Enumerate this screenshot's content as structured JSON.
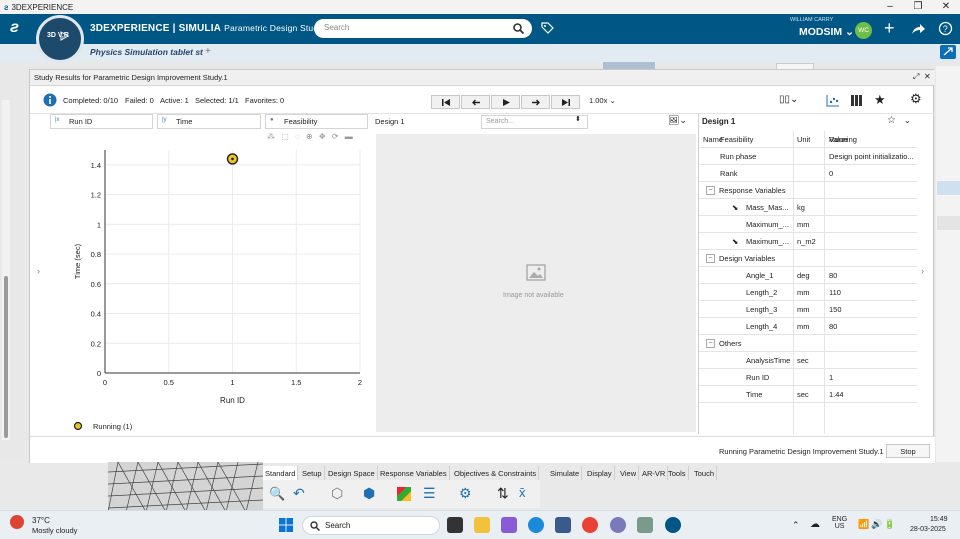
{
  "window": {
    "title": "3DEXPERIENCE",
    "controls": [
      "–",
      "❐",
      "✕"
    ]
  },
  "header": {
    "brand": "3DEXPERIENCE | SIMULIA",
    "brand_sub": "Parametric Design Study",
    "compass_label": "3D  V,R",
    "search_placeholder": "Search",
    "user_name": "WILLIAM CARRY",
    "user_app": "MODSIM",
    "avatar_initials": "WC",
    "tab_label": "Physics Simulation tablet st",
    "tab_plus": "+"
  },
  "panel": {
    "title": "Study Results for Parametric Design Improvement Study.1",
    "status": {
      "completed": "Completed: 0/10",
      "failed": "Failed: 0",
      "active": "Active: 1",
      "selected": "Selected: 1/1",
      "favorites": "Favorites: 0"
    },
    "speed": "1.00x",
    "filters": {
      "x": "Run ID",
      "y": "Time",
      "color": "Feasibility"
    },
    "design_label": "Design 1",
    "design_search_placeholder": "Search...",
    "image_missing": "Image not available",
    "legend": "Running (1)",
    "bottom_status": "Running Parametric Design Improvement Study.1",
    "stop_label": "Stop"
  },
  "chart_data": {
    "type": "scatter",
    "xlabel": "Run ID",
    "ylabel": "Time (sec)",
    "xlim": [
      0,
      2
    ],
    "ylim": [
      0,
      1.5
    ],
    "xticks": [
      "0",
      "0.5",
      "1",
      "1.5",
      "2"
    ],
    "yticks": [
      "0",
      "0.2",
      "0.4",
      "0.6",
      "0.8",
      "1",
      "1.2",
      "1.4"
    ],
    "x_tick_values": [
      0,
      0.5,
      1,
      1.5,
      2
    ],
    "y_tick_values": [
      0,
      0.2,
      0.4,
      0.6,
      0.8,
      1,
      1.2,
      1.4
    ],
    "series": [
      {
        "name": "Running (1)",
        "points": [
          {
            "x": 1,
            "y": 1.44
          }
        ],
        "color": "#e8c42a"
      }
    ]
  },
  "table": {
    "title": "Design 1",
    "columns": [
      "Name",
      "Unit",
      "Value"
    ],
    "rows": [
      {
        "indent": 1,
        "name": "Feasibility",
        "unit": "",
        "value": "Running"
      },
      {
        "indent": 1,
        "name": "Run phase",
        "unit": "",
        "value": "Design point initializatio..."
      },
      {
        "indent": 1,
        "name": "Rank",
        "unit": "",
        "value": "0"
      },
      {
        "indent": 0,
        "group": true,
        "name": "Response Variables",
        "unit": "",
        "value": ""
      },
      {
        "indent": 2,
        "name": "Mass_Mas...",
        "unit": "kg",
        "value": ""
      },
      {
        "indent": 2,
        "name": "Maximum_...",
        "unit": "mm",
        "value": ""
      },
      {
        "indent": 2,
        "name": "Maximum_...",
        "unit": "n_m2",
        "value": ""
      },
      {
        "indent": 0,
        "group": true,
        "name": "Design Variables",
        "unit": "",
        "value": ""
      },
      {
        "indent": 2,
        "name": "Angle_1",
        "unit": "deg",
        "value": "80"
      },
      {
        "indent": 2,
        "name": "Length_2",
        "unit": "mm",
        "value": "110"
      },
      {
        "indent": 2,
        "name": "Length_3",
        "unit": "mm",
        "value": "150"
      },
      {
        "indent": 2,
        "name": "Length_4",
        "unit": "mm",
        "value": "80"
      },
      {
        "indent": 0,
        "group": true,
        "name": "Others",
        "unit": "",
        "value": ""
      },
      {
        "indent": 2,
        "name": "AnalysisTime",
        "unit": "sec",
        "value": ""
      },
      {
        "indent": 2,
        "name": "Run ID",
        "unit": "",
        "value": "1"
      },
      {
        "indent": 2,
        "name": "Time",
        "unit": "sec",
        "value": "1.44"
      }
    ]
  },
  "action_tabs": [
    "Standard",
    "Setup",
    "Design Space",
    "Response Variables",
    "Objectives & Constraints",
    "Simulate",
    "Display",
    "View",
    "AR-VR",
    "Tools",
    "Touch"
  ],
  "taskbar": {
    "weather_temp": "37°C",
    "weather_desc": "Mostly cloudy",
    "search": "Search",
    "lang1": "ENG",
    "lang2": "US",
    "time": "15:49",
    "date": "28-03-2025"
  },
  "colors": {
    "brand_blue": "#005685",
    "point_yellow": "#e8c42a"
  }
}
